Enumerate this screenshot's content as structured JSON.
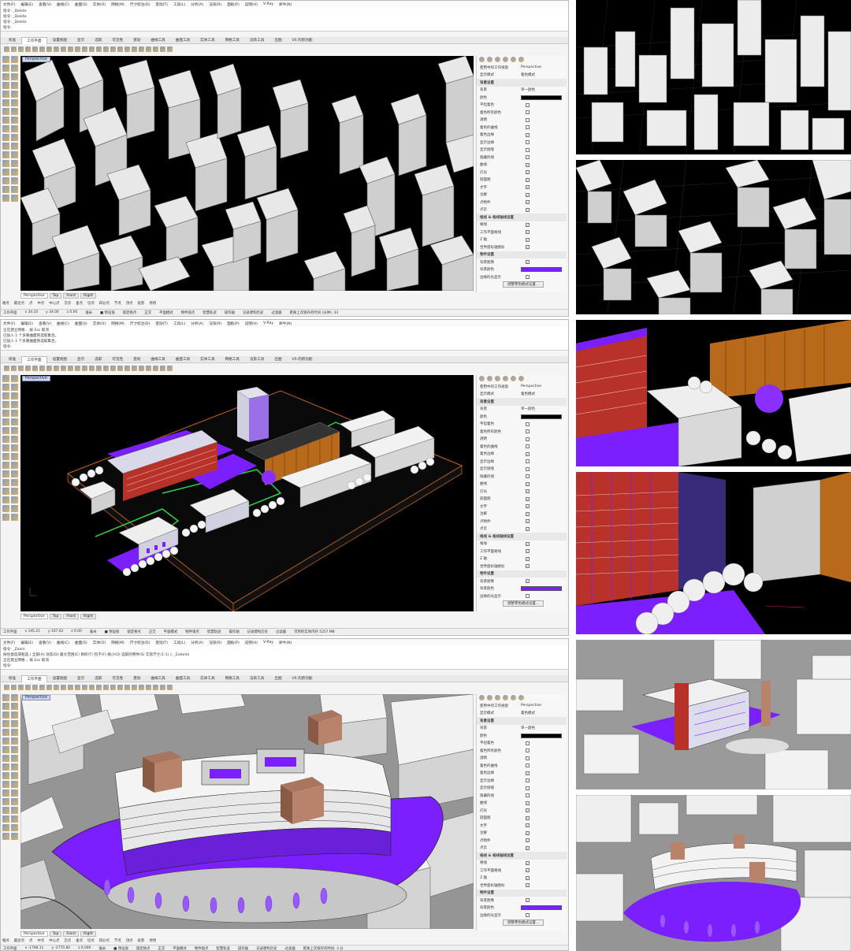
{
  "menu": [
    "文件(F)",
    "编辑(E)",
    "查看(V)",
    "曲线(C)",
    "曲面(S)",
    "实体(O)",
    "网格(M)",
    "尺寸标注(D)",
    "变动(T)",
    "工具(L)",
    "分析(A)",
    "渲染(R)",
    "面板(P)",
    "说明(H)",
    "V-Ray",
    "犀牛(N)"
  ],
  "tabs": [
    "标准",
    "工作平面",
    "设置视图",
    "显示",
    "选取",
    "可见性",
    "变动",
    "曲线工具",
    "曲面工具",
    "实体工具",
    "网格工具",
    "渲染工具",
    "出图",
    "V6 的新功能"
  ],
  "panels": [
    {
      "cmdlog": [
        "指令: _Delete",
        "指令: _Delete",
        "指令: _Delete",
        "指令:"
      ],
      "viewport_label": "Perspective",
      "viewport_tabs": [
        "Perspective",
        "Top",
        "Front",
        "Right"
      ],
      "osnap": [
        "端点",
        "最近点",
        "点",
        "中点",
        "中心点",
        "交点",
        "垂点",
        "切点",
        "四分点",
        "节点",
        "顶点",
        "投影",
        "停用"
      ],
      "status": [
        "工作平面",
        "x 34.10",
        "y 34.00",
        "z 0.00",
        "毫米",
        "■ 预设值",
        "锁定格点",
        "正交",
        "平面模式",
        "物件锁点",
        "智慧轨迹",
        "操作轴",
        "记录建构历史",
        "过滤器",
        "距离上次保存的时间 (分钟): 33"
      ]
    },
    {
      "cmdlog": [
        "正在建立网格... 按 Esc 取消",
        "已加入 1 个多重曲面到选取集合。",
        "已加入 1 个多重曲面到选取集合。",
        "指令:"
      ],
      "viewport_label": "Perspective",
      "viewport_tabs": [
        "Perspective",
        "Top",
        "Front",
        "Right"
      ],
      "osnap": [],
      "status": [
        "工作平面",
        "x 145.21",
        "y 107.62",
        "z 0.00",
        "毫米",
        "■ 预设值",
        "锁定格点",
        "正交",
        "平面模式",
        "物件锁点",
        "智慧轨迹",
        "操作轴",
        "记录建构历史",
        "过滤器",
        "可用的实体内存 5257 MB"
      ]
    },
    {
      "cmdlog": [
        "指令: _Zoom",
        "按住窗选或框选 ( 全部(A) 动态(D) 最大范围(E) 目标(T) 因子(F) 缩小(O) 选取的物件(S) 实际尺寸(1:1) ): _Extents",
        "正在建立网格... 按 Esc 取消",
        "指令:"
      ],
      "viewport_label": "Perspective",
      "viewport_tabs": [
        "Perspective",
        "Top",
        "Front",
        "Right"
      ],
      "osnap": [
        "端点",
        "最近点",
        "点",
        "中点",
        "中心点",
        "交点",
        "垂点",
        "切点",
        "四分点",
        "节点",
        "顶点",
        "投影",
        "停用"
      ],
      "status": [
        "工作平面",
        "x -1798.11",
        "y -2770.80",
        "z 0.000",
        "毫米",
        "■ 预设值",
        "锁定格点",
        "正交",
        "平面模式",
        "物件锁点",
        "智慧轨迹",
        "操作轴",
        "记录建构历史",
        "过滤器",
        "距离上次保存的时间: 3 分"
      ]
    }
  ],
  "properties": {
    "rows": [
      {
        "label": "使用中的工作视窗",
        "value": "Perspective",
        "kind": "text"
      },
      {
        "label": "显示模式",
        "value": "着色模式",
        "kind": "text"
      },
      {
        "label": "背景设置",
        "value": "",
        "kind": "section"
      },
      {
        "label": "背景",
        "value": "单一颜色",
        "kind": "text"
      },
      {
        "label": "颜色",
        "value": "",
        "kind": "black"
      },
      {
        "label": "平坦着色",
        "value": "",
        "kind": "cb0"
      },
      {
        "label": "着色所有颜色",
        "value": "",
        "kind": "cb0"
      },
      {
        "label": "透明",
        "value": "",
        "kind": "cb0"
      },
      {
        "label": "着色的曲线",
        "value": "",
        "kind": "cb0"
      },
      {
        "label": "着色边缘",
        "value": "",
        "kind": "cb1"
      },
      {
        "label": "显示边缘",
        "value": "",
        "kind": "cb0"
      },
      {
        "label": "显示接缝",
        "value": "",
        "kind": "cb0"
      },
      {
        "label": "隐藏的线",
        "value": "",
        "kind": "cb0"
      },
      {
        "label": "曲线",
        "value": "",
        "kind": "cb1"
      },
      {
        "label": "灯光",
        "value": "",
        "kind": "cb1"
      },
      {
        "label": "剖面图",
        "value": "",
        "kind": "cb1"
      },
      {
        "label": "文字",
        "value": "",
        "kind": "cb1"
      },
      {
        "label": "注解",
        "value": "",
        "kind": "cb1"
      },
      {
        "label": "点物件",
        "value": "",
        "kind": "cb1"
      },
      {
        "label": "点云",
        "value": "",
        "kind": "cb1"
      },
      {
        "label": "格线 & 格线轴线设置",
        "value": "",
        "kind": "section"
      },
      {
        "label": "格线",
        "value": "",
        "kind": "cb1"
      },
      {
        "label": "工作平面格线",
        "value": "",
        "kind": "cb1"
      },
      {
        "label": "Z 轴",
        "value": "",
        "kind": "cb1"
      },
      {
        "label": "世界座标轴图标",
        "value": "",
        "kind": "cb1"
      },
      {
        "label": "物件设置",
        "value": "",
        "kind": "section"
      },
      {
        "label": "背景图像",
        "value": "",
        "kind": "cb1"
      },
      {
        "label": "背景颜色",
        "value": "",
        "kind": "purple"
      },
      {
        "label": "边缘的光显示",
        "value": "",
        "kind": "cb0"
      },
      {
        "label": "",
        "value": "调整零色模式设置...",
        "kind": "button"
      }
    ]
  },
  "colors": {
    "accent": "#7b1fff",
    "brick": "#b8322a",
    "orange": "#b86a1a",
    "viewport_bg": "#000000"
  }
}
